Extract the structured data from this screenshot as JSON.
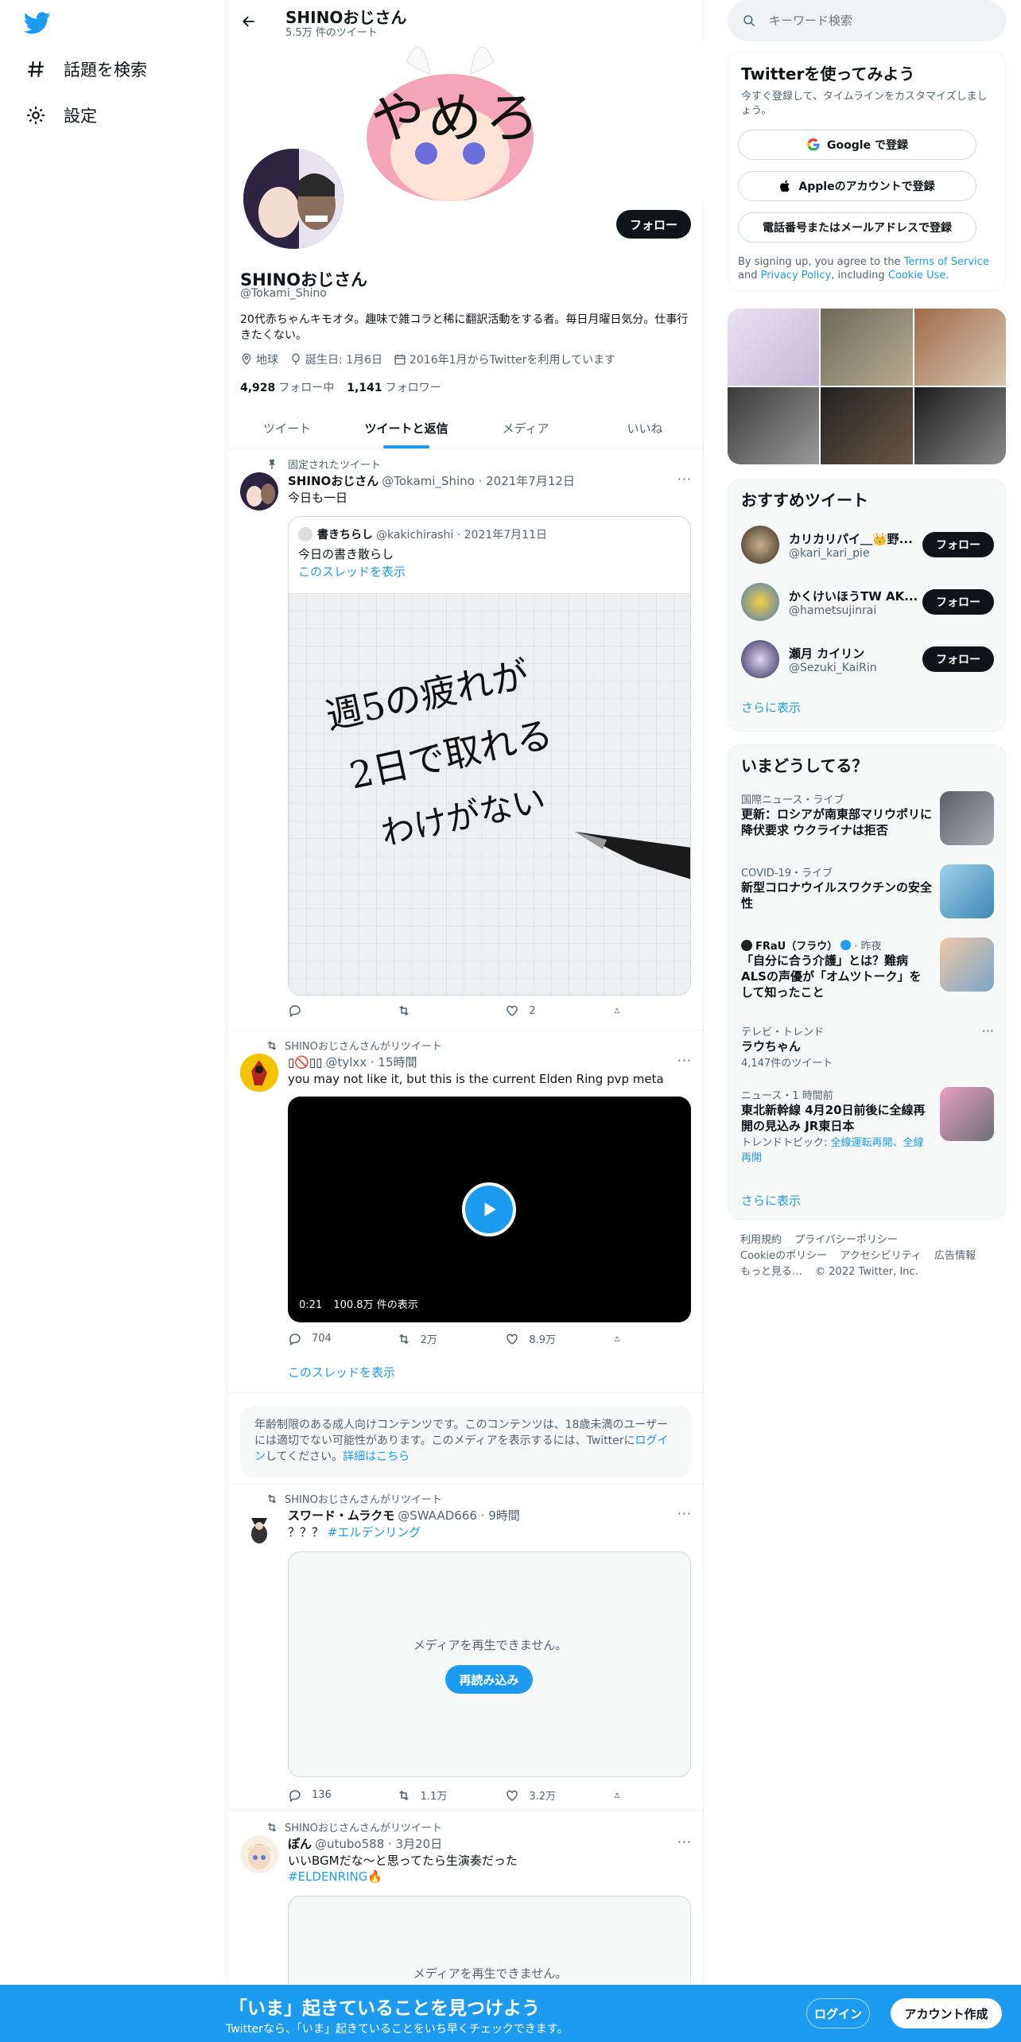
{
  "nav": {
    "explore": "話題を検索",
    "settings": "設定"
  },
  "profile": {
    "header_name": "SHINOおじさん",
    "tweet_count": "5.5万 件のツイート",
    "banner_text": "やめろ",
    "follow": "フォロー",
    "name": "SHINOおじさん",
    "handle": "@Tokami_Shino",
    "bio": "20代赤ちゃんキモオタ。趣味で雑コラと稀に翻訳活動をする者。毎日月曜日気分。仕事行きたくない。",
    "location": "地球",
    "birthday": "誕生日: 1月6日",
    "joined": "2016年1月からTwitterを利用しています",
    "following_count": "4,928",
    "following_label": "フォロー中",
    "followers_count": "1,141",
    "followers_label": "フォロワー"
  },
  "tabs": [
    "ツイート",
    "ツイートと返信",
    "メディア",
    "いいね"
  ],
  "tweets": {
    "t1": {
      "context": "固定されたツイート",
      "name": "SHINOおじさん",
      "meta": "@Tokami_Shino · 2021年7月12日",
      "text": "今日も一日",
      "quote": {
        "name": "書きちらし",
        "meta": "@kakichirashi · 2021年7月11日",
        "text": "今日の書き散らし",
        "thread": "このスレッドを表示",
        "image_text": [
          "週5の疲れが",
          "2日で取れる",
          "わけがない"
        ]
      },
      "likes": "2"
    },
    "t2": {
      "context": "SHINOおじさんさんがリツイート",
      "name": "",
      "meta": "@tylxx · 15時間",
      "text": "you may not like it, but this is the current Elden Ring pvp meta",
      "video_time": "0:21",
      "video_views": "100.8万 件の表示",
      "replies": "704",
      "retweets": "2万",
      "likes": "8.9万",
      "thread": "このスレッドを表示"
    },
    "warning": {
      "text": "年齢制限のある成人向けコンテンツです。このコンテンツは、18歳未満のユーザーには適切でない可能性があります。このメディアを表示するには、Twitterに",
      "login": "ログイン",
      "after": "してください。",
      "details": "詳細はこちら"
    },
    "t3": {
      "context": "SHINOおじさんさんがリツイート",
      "name": "スワード・ムラクモ",
      "meta": "@SWAAD666 · 9時間",
      "text": "？？？",
      "hashtag": "#エルデンリング",
      "media_error": "メディアを再生できません。",
      "reload": "再読み込み",
      "replies": "136",
      "retweets": "1.1万",
      "likes": "3.2万"
    },
    "t4": {
      "context": "SHINOおじさんさんがリツイート",
      "name": "ぽん",
      "meta": "@utubo588 · 3月20日",
      "text": "いいBGMだな〜と思ってたら生演奏だった",
      "hashtag": "#ELDENRING",
      "media_error": "メディアを再生できません。"
    }
  },
  "right": {
    "search_placeholder": "キーワード検索",
    "signup_title": "Twitterを使ってみよう",
    "signup_sub": "今すぐ登録して、タイムラインをカスタマイズしましょう。",
    "google": "Google で登録",
    "apple": "Appleのアカウントで登録",
    "phone": "電話番号またはメールアドレスで登録",
    "terms_a": "By signing up, you agree to the ",
    "terms_tos": "Terms of Service",
    "terms_and": " and ",
    "terms_pp": "Privacy Policy",
    "terms_inc": ", including ",
    "terms_cookie": "Cookie Use",
    "terms_end": ".",
    "reco_title": "おすすめツイート",
    "reco": [
      {
        "name": "カリカリパイ＿👑野...",
        "handle": "@kari_kari_pie",
        "btn": "フォロー"
      },
      {
        "name": "かくけいほうTW AK...",
        "handle": "@hametsujinrai",
        "btn": "フォロー"
      },
      {
        "name": "瀬月 カイリン",
        "handle": "@Sezuki_KaiRin",
        "btn": "フォロー"
      }
    ],
    "show_more": "さらに表示",
    "trends_title": "いまどうしてる？",
    "trends": [
      {
        "cat": "国際ニュース・ライブ",
        "title": "更新：ロシアが南東部マリウポリに降伏要求 ウクライナは拒否"
      },
      {
        "cat": "COVID-19・ライブ",
        "title": "新型コロナウイルスワクチンの安全性"
      },
      {
        "cat": "FRaU（フラウ）",
        "cat_time": "· 昨夜",
        "title": "「自分に合う介護」とは？難病ALSの声優が「オムツトーク」をして知ったこと"
      },
      {
        "cat": "テレビ・トレンド",
        "title": "ラウちゃん",
        "sub": "4,147件のツイート"
      },
      {
        "cat": "ニュース・1 時間前",
        "title": "東北新幹線 4月20日前後に全線再開の見込み JR東日本",
        "sub_label": "トレンドトピック: ",
        "sub_link": "全線運転再開、全線再開"
      }
    ],
    "trends_more": "さらに表示",
    "footer": [
      "利用規約",
      "プライバシーポリシー",
      "Cookieのポリシー",
      "アクセシビリティ",
      "広告情報",
      "もっと見る…",
      "© 2022 Twitter, Inc."
    ]
  },
  "bottom": {
    "title": "「いま」起きていることを見つけよう",
    "sub": "Twitterなら、「いま」起きていることをいち早くチェックできます。",
    "login": "ログイン",
    "signup": "アカウント作成"
  },
  "colors": {
    "accent": "#1d9bf0",
    "text": "#0f1419",
    "muted": "#536471"
  }
}
